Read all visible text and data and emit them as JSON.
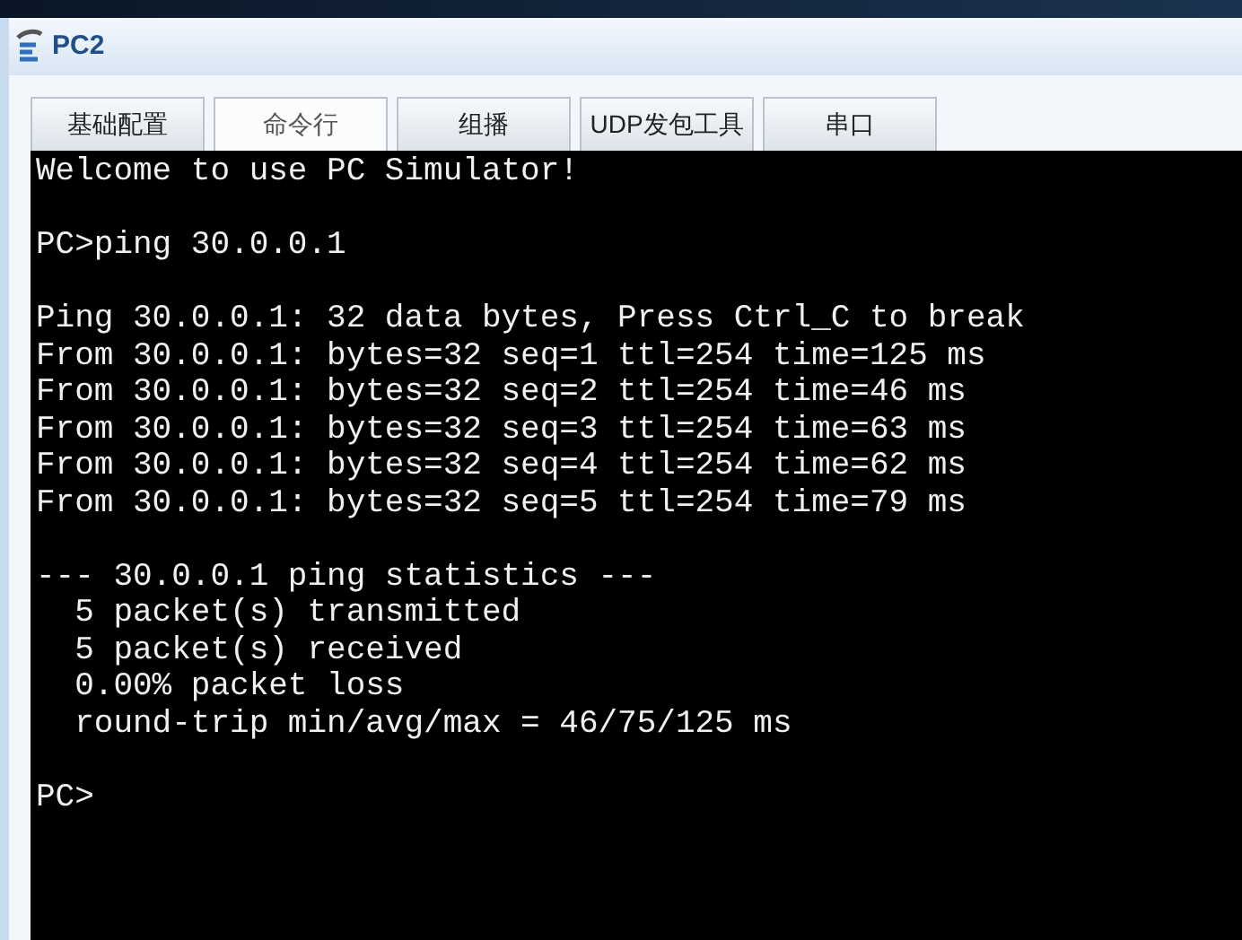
{
  "window": {
    "title": "PC2"
  },
  "tabs": [
    {
      "label": "基础配置",
      "selected": false
    },
    {
      "label": "命令行",
      "selected": true
    },
    {
      "label": "组播",
      "selected": false
    },
    {
      "label": "UDP发包工具",
      "selected": false
    },
    {
      "label": "串口",
      "selected": false
    }
  ],
  "terminal": {
    "blocks": [
      [
        "Welcome to use PC Simulator!"
      ],
      [
        "PC>ping 30.0.0.1"
      ],
      [
        "Ping 30.0.0.1: 32 data bytes, Press Ctrl_C to break",
        "From 30.0.0.1: bytes=32 seq=1 ttl=254 time=125 ms",
        "From 30.0.0.1: bytes=32 seq=2 ttl=254 time=46 ms",
        "From 30.0.0.1: bytes=32 seq=3 ttl=254 time=63 ms",
        "From 30.0.0.1: bytes=32 seq=4 ttl=254 time=62 ms",
        "From 30.0.0.1: bytes=32 seq=5 ttl=254 time=79 ms"
      ],
      [
        "--- 30.0.0.1 ping statistics ---",
        "  5 packet(s) transmitted",
        "  5 packet(s) received",
        "  0.00% packet loss",
        "  round-trip min/avg/max = 46/75/125 ms"
      ],
      [
        "PC>"
      ]
    ]
  }
}
